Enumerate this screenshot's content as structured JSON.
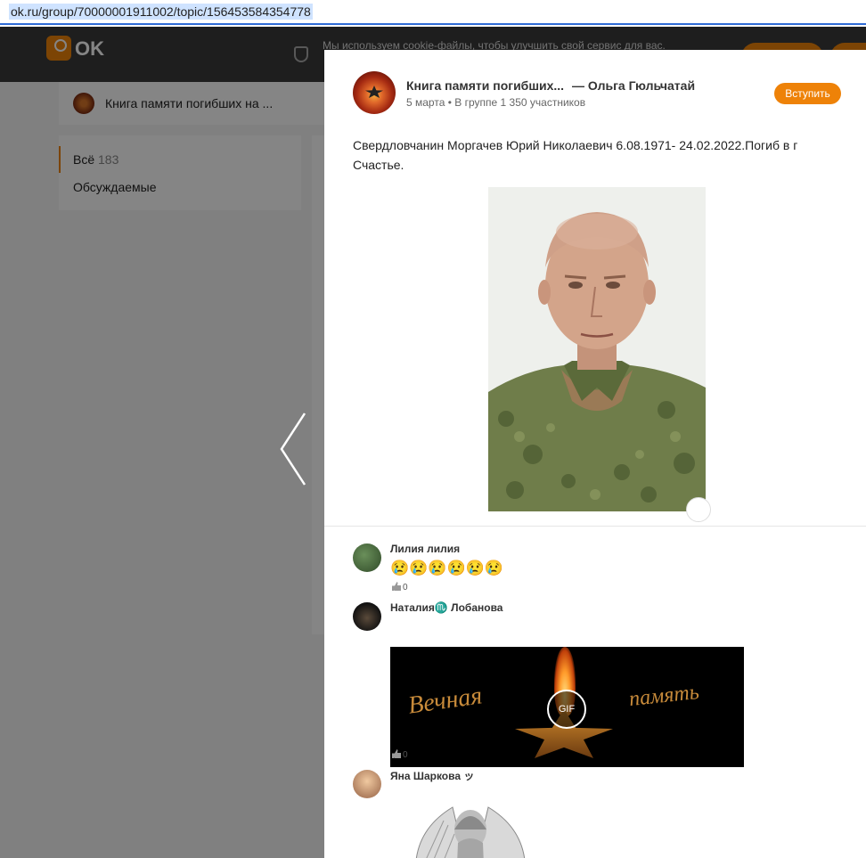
{
  "browser": {
    "url": "ok.ru/group/70000001911002/topic/156453584354778"
  },
  "header": {
    "logo_text": "OK",
    "cookie_text": "Мы используем cookie-файлы, чтобы улучшить свой сервис для вас."
  },
  "background": {
    "group_name": "Книга памяти погибших на ...",
    "nav": {
      "all_label": "Всё",
      "all_count": "183",
      "discussed_label": "Обсуждаемые"
    }
  },
  "post": {
    "group_name": "Книга памяти погибших...",
    "author": "— Ольга Гюльчатай",
    "date": "5 марта",
    "group_info": "• В группе 1 350 участников",
    "join_label": "Вступить",
    "text": "Свердловчанин Моргачев Юрий Николаевич 6.08.1971- 24.02.2022.Погиб в г Счастье."
  },
  "comments": [
    {
      "author": "Лилия лилия",
      "emoji": "😢😢😢😢😢😢",
      "likes": "0"
    },
    {
      "author": "Наталия♏ Лобанова",
      "likes": "0",
      "gif_badge": "GIF",
      "gif_text_left": "Вечная",
      "gif_text_right": "память"
    },
    {
      "author": "Яна Шаркова ッ"
    }
  ],
  "colors": {
    "accent": "#ee8208",
    "overlay": "rgba(0,0,0,0.48)"
  }
}
